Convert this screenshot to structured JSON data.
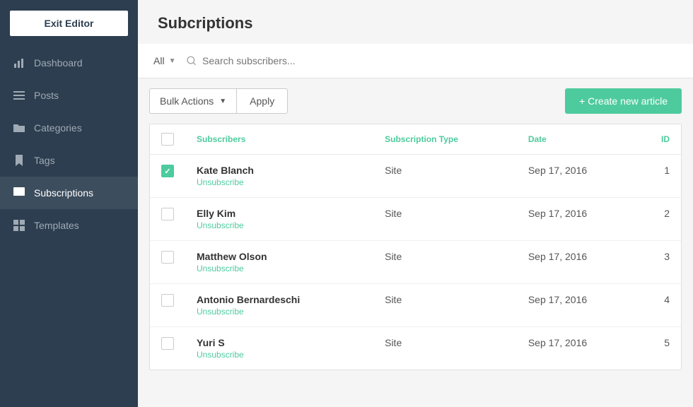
{
  "sidebar": {
    "exit_editor_label": "Exit Editor",
    "items": [
      {
        "id": "dashboard",
        "label": "Dashboard",
        "icon": "bar-chart-icon",
        "active": false
      },
      {
        "id": "posts",
        "label": "Posts",
        "icon": "list-icon",
        "active": false
      },
      {
        "id": "categories",
        "label": "Categories",
        "icon": "folder-icon",
        "active": false
      },
      {
        "id": "tags",
        "label": "Tags",
        "icon": "bookmark-icon",
        "active": false
      },
      {
        "id": "subscriptions",
        "label": "Subscriptions",
        "icon": "image-icon",
        "active": true
      },
      {
        "id": "templates",
        "label": "Templates",
        "icon": "grid-icon",
        "active": false
      }
    ]
  },
  "page": {
    "title": "Subcriptions"
  },
  "filter_bar": {
    "all_label": "All",
    "search_placeholder": "Search subscribers..."
  },
  "toolbar": {
    "bulk_actions_label": "Bulk Actions",
    "apply_label": "Apply",
    "create_label": "+ Create new article"
  },
  "table": {
    "columns": [
      "Subscribers",
      "Subscription Type",
      "Date",
      "ID"
    ],
    "rows": [
      {
        "id": 1,
        "name": "Kate Blanch",
        "subscription_type": "Site",
        "date": "Sep 17, 2016",
        "checked": true
      },
      {
        "id": 2,
        "name": "Elly Kim",
        "subscription_type": "Site",
        "date": "Sep 17, 2016",
        "checked": false
      },
      {
        "id": 3,
        "name": "Matthew Olson",
        "subscription_type": "Site",
        "date": "Sep 17, 2016",
        "checked": false
      },
      {
        "id": 4,
        "name": "Antonio Bernardeschi",
        "subscription_type": "Site",
        "date": "Sep 17, 2016",
        "checked": false
      },
      {
        "id": 5,
        "name": "Yuri S",
        "subscription_type": "Site",
        "date": "Sep 17, 2016",
        "checked": false
      }
    ],
    "unsubscribe_label": "Unsubscribe",
    "colors": {
      "accent": "#4ecb9e"
    }
  }
}
